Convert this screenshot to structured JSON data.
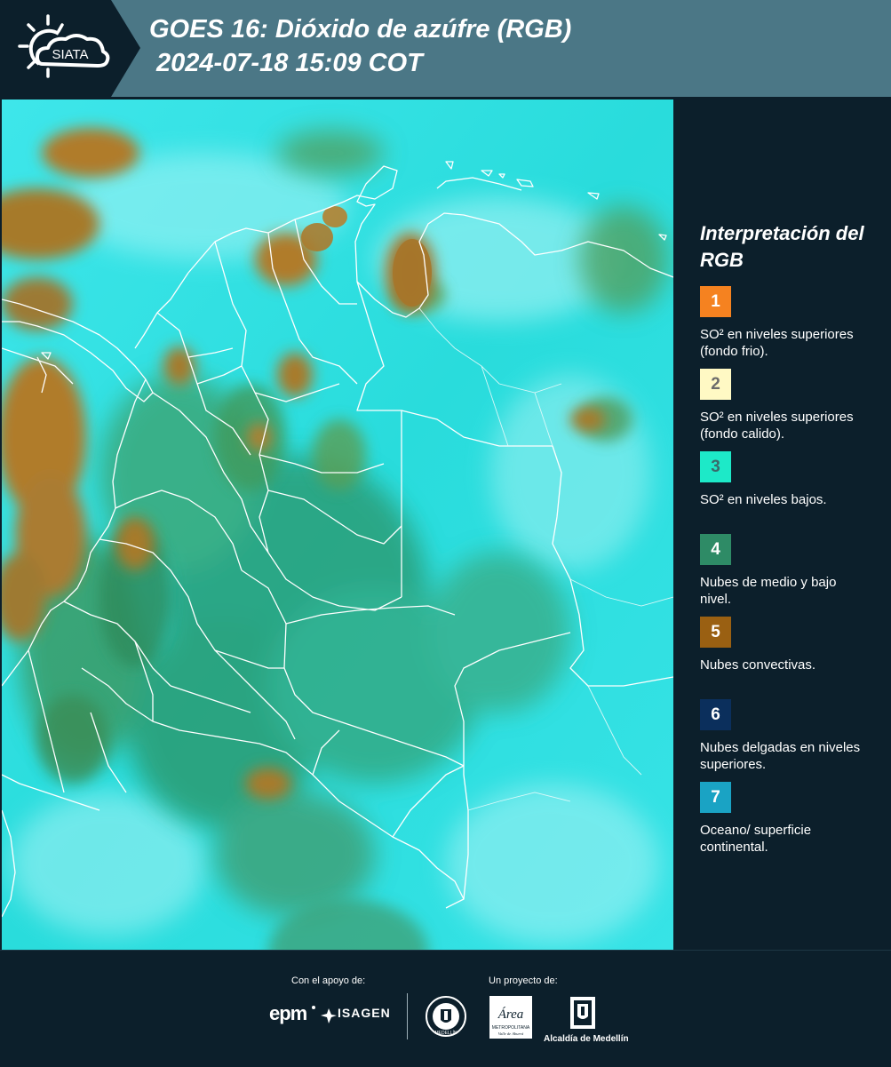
{
  "header": {
    "logo_text": "SIATA",
    "title_line1": "GOES 16: Dióxido de azúfre (RGB)",
    "title_line2": "2024-07-18 15:09 COT"
  },
  "map": {
    "ocean_color": "#2fe0e0",
    "cloud_orange": "#a87a22",
    "cloud_green": "#3a9a6a",
    "border_color": "#ffffff"
  },
  "legend": {
    "title": "Interpretación del RGB",
    "items": [
      {
        "number": "1",
        "color": "#f58220",
        "text_color": "#ffffff",
        "label": "SO² en niveles superiores (fondo frio)."
      },
      {
        "number": "2",
        "color": "#fff9c4",
        "text_color": "#6b6b6b",
        "label": "SO² en niveles superiores (fondo calido)."
      },
      {
        "number": "3",
        "color": "#1de9c8",
        "text_color": "#3a6a6a",
        "label": "SO² en niveles bajos."
      },
      {
        "number": "4",
        "color": "#2e8b66",
        "text_color": "#ffffff",
        "label": "Nubes de medio y bajo nivel."
      },
      {
        "number": "5",
        "color": "#9a6012",
        "text_color": "#ffffff",
        "label": "Nubes convectivas."
      },
      {
        "number": "6",
        "color": "#0b2f5c",
        "text_color": "#ffffff",
        "label": "Nubes delgadas en niveles superiores."
      },
      {
        "number": "7",
        "color": "#1aa3c4",
        "text_color": "#ffffff",
        "label": "Oceano/ superficie continental."
      }
    ]
  },
  "footer": {
    "support_label": "Con el apoyo de:",
    "project_label": "Un proyecto de:",
    "epm_logo": "epm",
    "isagen_logo": "ISAGEN",
    "area_logo_text": "Área",
    "area_sub_text": "METROPOLITANA",
    "area_sub_text2": "Valle de Aburrá",
    "alcaldia_text": "Alcaldía de Medellín",
    "seal_text": "MEDELLÍN"
  }
}
